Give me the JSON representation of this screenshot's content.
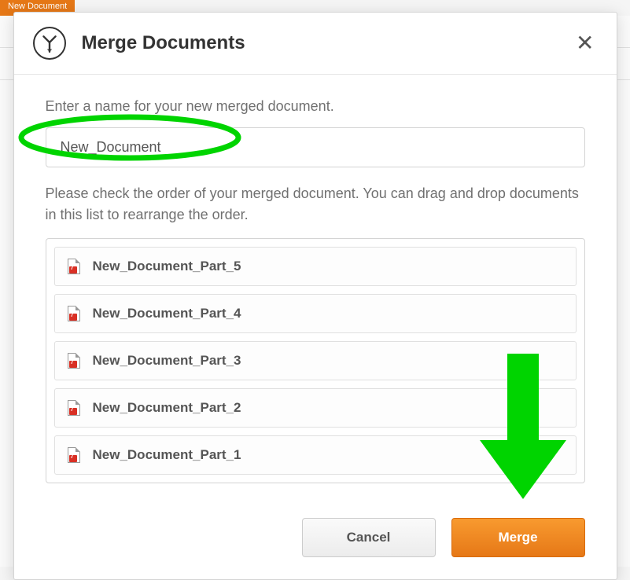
{
  "background": {
    "new_doc_button": "New Document"
  },
  "modal": {
    "title": "Merge Documents",
    "prompt_name": "Enter a name for your new merged document.",
    "input_value": "New_Document",
    "prompt_order": "Please check the order of your merged document. You can drag and drop documents in this list to rearrange the order.",
    "documents": [
      {
        "name": "New_Document_Part_5"
      },
      {
        "name": "New_Document_Part_4"
      },
      {
        "name": "New_Document_Part_3"
      },
      {
        "name": "New_Document_Part_2"
      },
      {
        "name": "New_Document_Part_1"
      }
    ],
    "cancel_label": "Cancel",
    "merge_label": "Merge"
  },
  "annotations": {
    "circle_color": "#00d400",
    "arrow_color": "#00d400"
  }
}
